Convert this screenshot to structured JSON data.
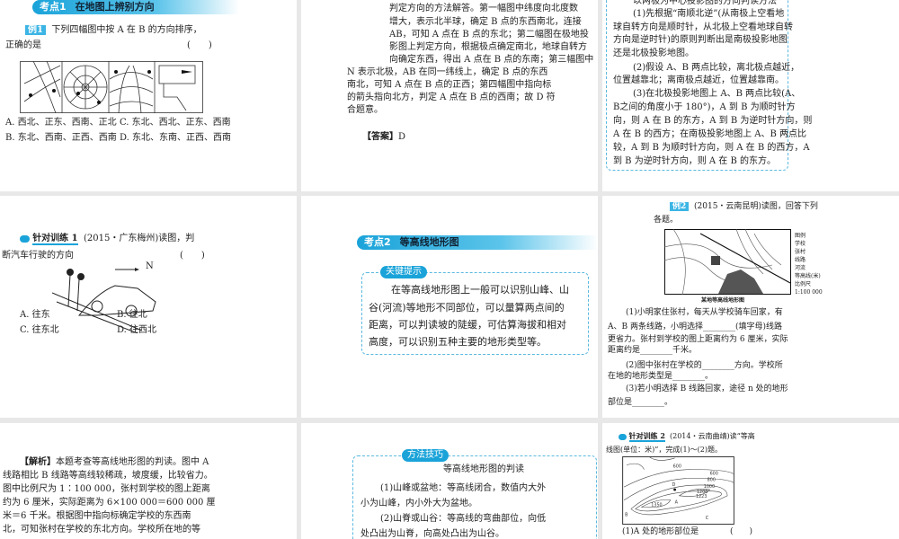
{
  "cell1": {
    "banner_num": "考点1",
    "banner_title": "在地图上辨别方向",
    "example_tag": "例1",
    "question_l1": "下列四幅图中按 A 在 B 的方向排序，",
    "question_l2": "正确的是",
    "paren": "(　　)",
    "options": [
      "A. 西北、正东、西南、正北",
      "C. 东北、西北、正东、西南",
      "B. 东北、西南、正西、西南",
      "D. 东北、东南、正西、西南"
    ]
  },
  "cell2": {
    "lines": [
      "判定方向的方法解答。第一幅图中纬度向北度数",
      "增大，表示北半球，确定 B 点的东西南北，连接",
      "AB，可知 A 点在 B 点的东北；第二幅图在极地投",
      "影图上判定方向，根据极点确定南北，地球自转方",
      "向确定东西，得出 A 点在 B 点的东南；第三幅图中",
      "N 表示北极，AB 在同一纬线上，确定 B 点的东西",
      "南北，可知 A 点在 B 点的正西；第四幅图中指向标",
      "的箭头指向北方，判定 A 点在 B 点的西南；故 D 符",
      "合题意。"
    ],
    "answer_label": "【答案】",
    "answer": "D"
  },
  "cell3": {
    "lines": [
      "以两极为中心投影图的方向判读方法",
      "(1)先根据“南顺北逆”(从南极上空看地",
      "球自转方向是顺时针，从北极上空看地球自转",
      "方向是逆时针)的原则判断出是南极投影地图",
      "还是北极投影地图。",
      "(2)假设 A、B 两点比较，离北极点越近，",
      "位置越靠北；离南极点越近，位置越靠南。",
      "(3)在北极投影地图上 A、B 两点比较(A、",
      "B之间的角度小于 180°)，A 到 B 为顺时针方",
      "向，则 A 在 B 的东方，A 到 B 为逆时针方向，则",
      "A 在 B 的西方；在南极投影地图上 A、B 两点比",
      "较，A 到 B 为顺时针方向，则 A 在 B 的西方，A",
      "到 B 为逆时针方向，则 A 在 B 的东方。"
    ]
  },
  "cell4": {
    "title": "针对训练 1",
    "q_l1": "(2015・广东梅州)读图，判",
    "q_l2": "断汽车行驶的方向",
    "paren": "(　　)",
    "north": "N",
    "options": [
      "A. 往东",
      "B. 往北",
      "C. 往东北",
      "D. 往西北"
    ]
  },
  "cell5": {
    "banner_num": "考点2",
    "banner_title": "等高线地形图",
    "tag": "关键提示",
    "lines": [
      "在等高线地形图上一般可以识别山峰、山",
      "谷(河流)等地形不同部位，可以量算两点间的",
      "距离，可以判读坡的陡缓，可估算海拔和相对",
      "高度，可以识别五种主要的地形类型等。"
    ]
  },
  "cell6": {
    "example_tag": "例2",
    "q_l1": "(2015・云南昆明)读图，回答下列",
    "q_l2": "各题。",
    "map_caption": "某地等高线地形图",
    "legend": [
      "图例",
      "学校",
      "张村",
      "线路",
      "河流",
      "等高线(米)",
      "比例尺",
      "1:100 000"
    ],
    "lines": [
      "(1)小明家住张村，每天从学校骑车回家，有",
      "A、B 两条线路，小明选择________(填字母)线路",
      "更省力。张村到学校的图上距离约为 6 厘米，实际",
      "距离约是________千米。",
      "(2)图中张村在学校的________方向。学校所",
      "在地的地形类型是________。",
      "(3)若小明选择 B 线路回家，途径 n 处的地形",
      "部位是________。"
    ]
  },
  "cell7": {
    "label": "【解析】",
    "lines": [
      "本题考查等高线地形图的判读。图中 A",
      "线路相比 B 线路等高线较稀疏，坡度缓，比较省力。",
      "图中比例尺为 1∶100 000，张村到学校的图上距离",
      "约为 6 厘米，实际距离为 6×100 000＝600 000 厘",
      "米＝6 千米。根据图中指向标确定学校的东西南",
      "北，可知张村在学校的东北方向。学校所在地的等"
    ]
  },
  "cell8": {
    "tag": "方法技巧",
    "title": "等高线地形图的判读",
    "lines": [
      "(1)山峰或盆地：等高线闭合，数值内大外",
      "小为山峰，内小外大为盆地。",
      "(2)山脊或山谷：等高线的弯曲部位，向低",
      "处凸出为山脊，向高处凸出为山谷。"
    ]
  },
  "cell9": {
    "title": "针对训练 2",
    "q_l1": "(2014・云南曲靖)读“等高",
    "q_l2": "线图(单位：米)”，完成(1)～(2)题。",
    "map_labels": [
      "600",
      "600",
      "800",
      "1000",
      "1200",
      "1223",
      "1350",
      "A",
      "B",
      "C",
      "D"
    ],
    "q1": "(1)A 处的地形部位是",
    "paren": "(　　)"
  }
}
